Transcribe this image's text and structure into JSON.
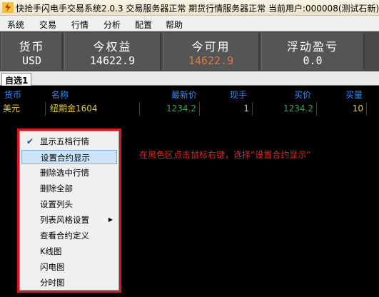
{
  "window": {
    "title": "快抢手闪电手交易系统2.0.3 交易服务器正常  期货行情服务器正常 当前用户:000008(测试石新)"
  },
  "menubar": [
    "系统",
    "交易",
    "行情",
    "分析",
    "配置",
    "帮助"
  ],
  "summary": [
    {
      "label": "货币",
      "value": "USD",
      "value_color": "#ffffff"
    },
    {
      "label": "今权益",
      "value": "14622.9",
      "value_color": "#ffffff"
    },
    {
      "label": "今可用",
      "value": "14622.9",
      "value_color": "#e07a3c"
    },
    {
      "label": "浮动盈亏",
      "value": "0.0",
      "value_color": "#ffffff"
    }
  ],
  "tabs": [
    "自选1"
  ],
  "table": {
    "headers": [
      "货币",
      "名称",
      "最新价",
      "现手",
      "买价",
      "买量"
    ],
    "rows": [
      {
        "currency": "美元",
        "name": "纽期金1604",
        "last": "1234.2",
        "vol": "1",
        "bid": "1234.2",
        "bid_qty": "10"
      }
    ]
  },
  "context_menu": {
    "items": [
      {
        "label": "显示五档行情",
        "checked": true
      },
      {
        "label": "设置合约显示",
        "highlighted": true
      },
      {
        "label": "删除选中行情"
      },
      {
        "label": "删除全部"
      },
      {
        "label": "设置列头"
      },
      {
        "label": "列表风格设置",
        "submenu": true
      },
      {
        "label": "查看合约定义"
      },
      {
        "label": "K线图"
      },
      {
        "label": "闪电图"
      },
      {
        "label": "分时图"
      }
    ]
  },
  "annotation": "在黑色区点击鼠标右键，选择”设置合约显示”",
  "colors": {
    "header_blue": "#2e8bff",
    "price_green": "#21b14a",
    "qty_yellow": "#e8d21a",
    "name_yellow": "#e8d21a",
    "annotation_red": "#e8231f",
    "menu_border_red": "#e0101c",
    "summary_bg": "#555555"
  }
}
